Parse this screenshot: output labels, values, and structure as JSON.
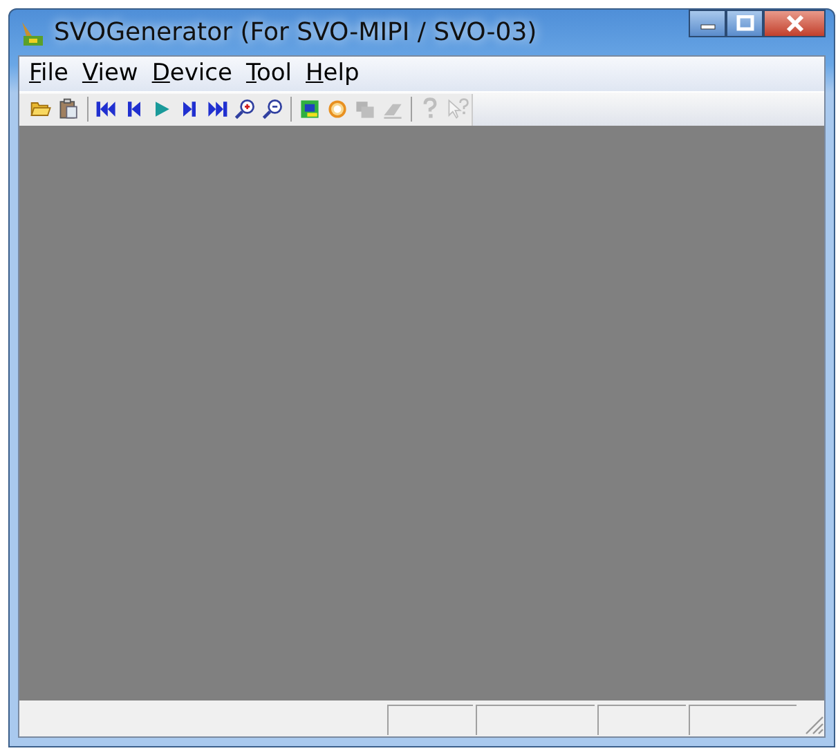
{
  "window": {
    "title": "SVOGenerator (For SVO-MIPI / SVO-03)"
  },
  "menu": [
    "File",
    "View",
    "Device",
    "Tool",
    "Help"
  ],
  "toolbar": {
    "groups": [
      [
        {
          "kind": "open",
          "disabled": false
        },
        {
          "kind": "clipboard",
          "disabled": false
        }
      ],
      [
        {
          "kind": "first",
          "disabled": false
        },
        {
          "kind": "prev",
          "disabled": false
        },
        {
          "kind": "play",
          "disabled": false
        },
        {
          "kind": "next",
          "disabled": false
        },
        {
          "kind": "last",
          "disabled": false
        },
        {
          "kind": "zoom-in",
          "disabled": false
        },
        {
          "kind": "zoom-out",
          "disabled": false
        }
      ],
      [
        {
          "kind": "chip",
          "disabled": false
        },
        {
          "kind": "gear",
          "disabled": false
        },
        {
          "kind": "copy",
          "disabled": true
        },
        {
          "kind": "eraser",
          "disabled": true
        }
      ],
      [
        {
          "kind": "help",
          "disabled": true
        },
        {
          "kind": "context-help",
          "disabled": true
        }
      ]
    ]
  }
}
